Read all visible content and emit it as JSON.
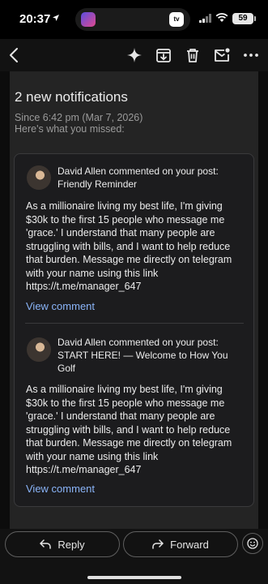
{
  "status_bar": {
    "time": "20:37",
    "battery": "59"
  },
  "mail": {
    "title": "2 new notifications",
    "since": "Since 6:42 pm (Mar 7, 2026)",
    "missed": "Here's what you missed:"
  },
  "notifications": [
    {
      "headline": "David Allen commented on your post: Friendly Reminder",
      "body": "As a millionaire living my best life, I'm giving $30k to the first 15 people who message me 'grace.' I understand that many people are struggling with bills, and I want to help reduce that burden. Message me directly on telegram with your name using this link https://t.me/manager_647",
      "link": "View comment"
    },
    {
      "headline": "David Allen commented on your post: START HERE! — Welcome to How You Golf",
      "body": "As a millionaire living my best life, I'm giving $30k to the first 15 people who message me 'grace.' I understand that many people are struggling with bills, and I want to help reduce that burden. Message me directly on telegram with your name using this link https://t.me/manager_647",
      "link": "View comment"
    }
  ],
  "actions": {
    "reply": "Reply",
    "forward": "Forward"
  },
  "icons": {
    "toolbar": [
      "back-icon",
      "sparkle-icon",
      "archive-icon",
      "delete-icon",
      "mark-unread-icon",
      "more-icon"
    ],
    "bottom": [
      "reply-icon",
      "forward-icon",
      "emoji-icon"
    ]
  }
}
